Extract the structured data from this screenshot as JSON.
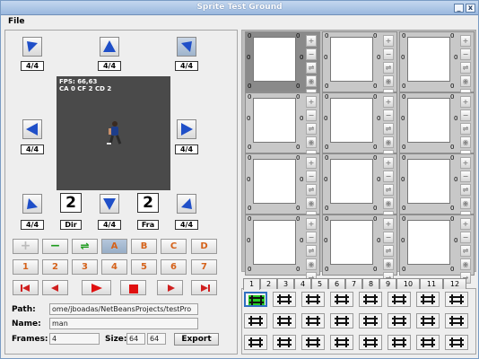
{
  "window": {
    "title": "Sprite Test Ground",
    "controls": [
      "_",
      "x"
    ]
  },
  "menu": {
    "file": "File"
  },
  "directions": {
    "counters": [
      "4/4",
      "4/4",
      "4/4",
      "4/4",
      "4/4",
      "4/4",
      "4/4",
      "4/4"
    ]
  },
  "preview": {
    "fps": "FPS: 66,63",
    "state": "CA 0 CF 2 CD 2"
  },
  "dir": {
    "value": "2",
    "label": "Dir"
  },
  "fra": {
    "value": "2",
    "label": "Fra"
  },
  "toolbar_row1": {
    "add": "+",
    "remove": "−",
    "swap": "⇌",
    "a": "A",
    "b": "B",
    "c": "C",
    "d": "D"
  },
  "toolbar_row2": [
    "1",
    "2",
    "3",
    "4",
    "5",
    "6",
    "7"
  ],
  "playback": [
    "first",
    "prev",
    "play",
    "stop",
    "next",
    "last"
  ],
  "form": {
    "path_label": "Path:",
    "path_value": "ome/jboadas/NetBeansProjects/testPro",
    "name_label": "Name:",
    "name_value": "man",
    "frames_label": "Frames:",
    "frames_value": "4",
    "size_label": "Size:",
    "size_w": "64",
    "size_h": "64",
    "export": "Export"
  },
  "cells": {
    "zero": "0",
    "side_buttons": [
      "+",
      "−",
      "⇌",
      "◉",
      "→"
    ]
  },
  "tabs": [
    "1",
    "2",
    "3",
    "4",
    "5",
    "6",
    "7",
    "8",
    "9",
    "10",
    "11",
    "12"
  ],
  "colors": {
    "accent": "#2f6fc0",
    "arrow": "#1f4fc8"
  }
}
